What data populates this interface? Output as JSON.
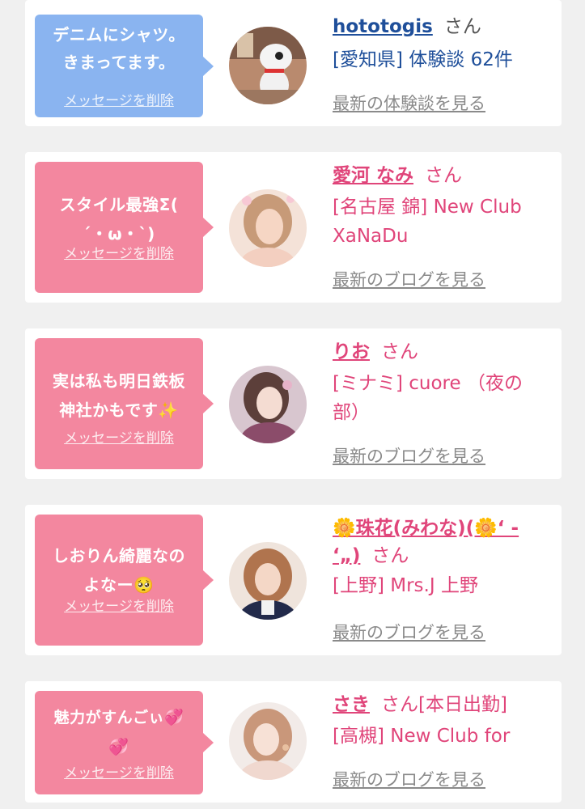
{
  "cards": [
    {
      "message_lines": [
        "デニムにシャツ。",
        "きまってます。"
      ],
      "delete_label": "メッセージを削除",
      "name": "hototogis",
      "honorific": "さん",
      "location": "[愛知県] 体験談 62件",
      "link": "最新の体験談を見る",
      "bubble_color": "#8ab4f0"
    },
    {
      "message_lines": [
        "スタイル最強Σ(",
        "´・ω・`)"
      ],
      "delete_label": "メッセージを削除",
      "name": "愛河 なみ",
      "honorific": "さん",
      "location_lines": [
        "[名古屋 錦] New Club",
        "XaNaDu"
      ],
      "link": "最新のブログを見る",
      "bubble_color": "#f3879f"
    },
    {
      "message_lines": [
        "実は私も明日鉄板",
        "神社かもです✨"
      ],
      "delete_label": "メッセージを削除",
      "name": "りお",
      "honorific": "さん",
      "location_lines": [
        "[ミナミ] cuore （夜の",
        "部）"
      ],
      "link": "最新のブログを見る",
      "bubble_color": "#f3879f"
    },
    {
      "message_lines": [
        "しおりん綺麗なの",
        "よなー🥺"
      ],
      "delete_label": "メッセージを削除",
      "name_lines": [
        "🌼珠花(みわな)(🌼‘ -",
        "‘„)"
      ],
      "honorific": "さん",
      "location": "[上野] Mrs.J 上野",
      "link": "最新のブログを見る",
      "bubble_color": "#f3879f"
    },
    {
      "message_lines": [
        "魅力がすんごぃ💞",
        "💞"
      ],
      "delete_label": "メッセージを削除",
      "name": "さき",
      "honorific": "さん[本日出勤]",
      "location": "[高槻] New Club for",
      "link": "最新のブログを見る",
      "bubble_color": "#f3879f"
    }
  ],
  "colors": {
    "page_bg": "#f0f0f0",
    "accent_pink": "#e0457a",
    "link_blue": "#1f4f9a"
  }
}
